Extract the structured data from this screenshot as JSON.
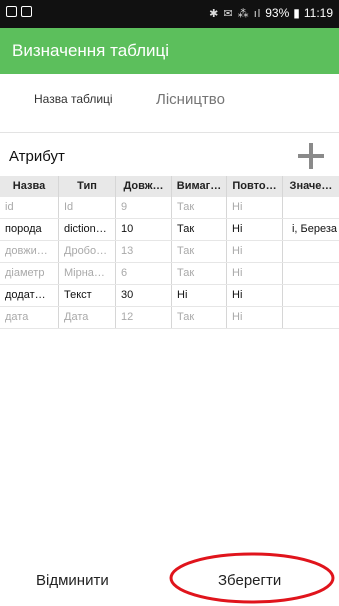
{
  "status_bar": {
    "icons": "✱ ✉ ⁂ ıl",
    "battery": "93%",
    "time": "11:19"
  },
  "app_bar": {
    "title": "Визначення таблиці"
  },
  "form": {
    "name_label": "Назва таблиці",
    "name_value": "Лісництво"
  },
  "attributes": {
    "title": "Атрибут",
    "add_icon": "plus-icon",
    "columns": [
      "Назва",
      "Тип",
      "Довж…",
      "Вимаг…",
      "Повто…",
      "Значе…"
    ],
    "rows": [
      {
        "state": "inactive",
        "cells": [
          "id",
          "Id",
          "9",
          "Так",
          "Ні",
          ""
        ]
      },
      {
        "state": "active",
        "cells": [
          "порода",
          "diction…",
          "10",
          "Так",
          "Ні",
          "і, Береза"
        ]
      },
      {
        "state": "inactive",
        "cells": [
          "довжи…",
          "Дробо…",
          "13",
          "Так",
          "Ні",
          ""
        ]
      },
      {
        "state": "inactive",
        "cells": [
          "діаметр",
          "Мірна…",
          "6",
          "Так",
          "Ні",
          ""
        ]
      },
      {
        "state": "active",
        "cells": [
          "додат…",
          "Текст",
          "30",
          "Ні",
          "Ні",
          ""
        ]
      },
      {
        "state": "inactive",
        "cells": [
          "дата",
          "Дата",
          "12",
          "Так",
          "Ні",
          ""
        ]
      }
    ]
  },
  "actions": {
    "cancel_label": "Відминити",
    "save_label": "Зберегти"
  },
  "colors": {
    "app_bar": "#5cbf5c",
    "annotation_circle": "#e0141c"
  }
}
